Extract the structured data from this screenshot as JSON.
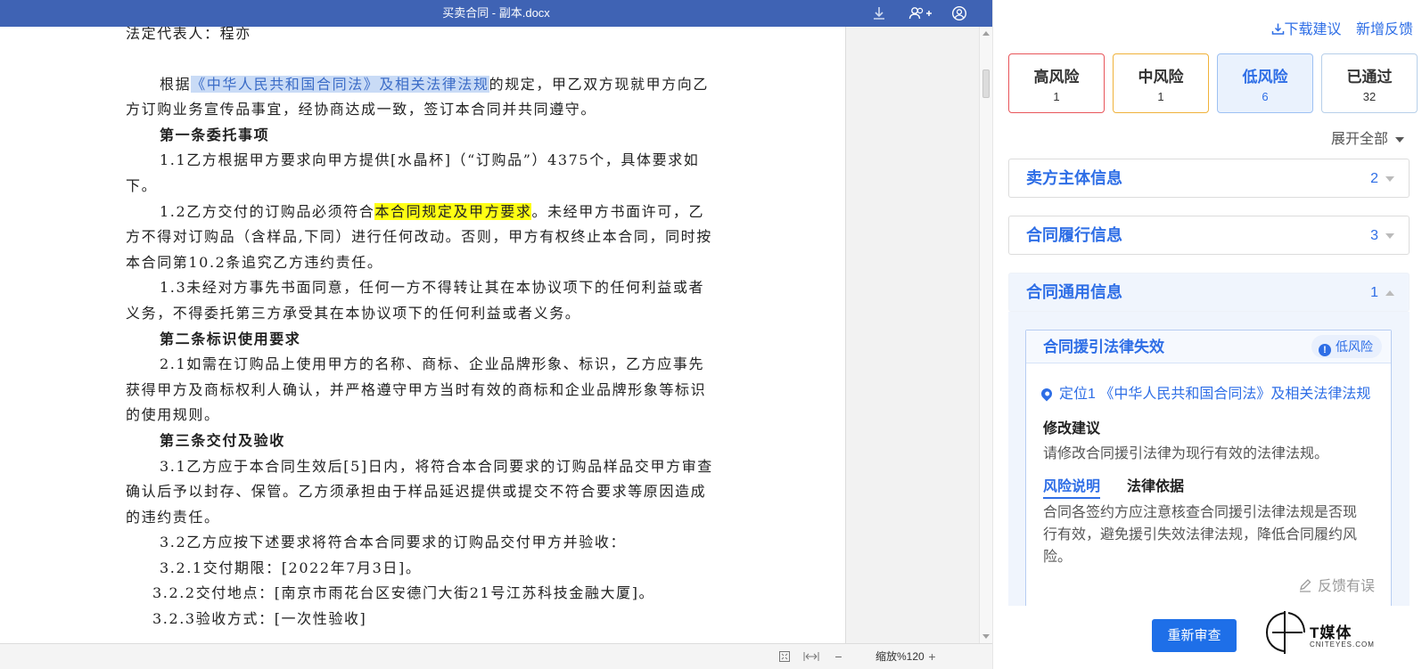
{
  "window": {
    "title": "买卖合同 - 副本.docx",
    "icons": [
      "download-icon",
      "add-user-icon",
      "account-icon"
    ]
  },
  "document": {
    "top_line": "法定代表人：程亦",
    "intro_prefix": "根据",
    "intro_highlight": "《中华人民共和国合同法》及相关法律法规",
    "intro_suffix": "的规定，甲乙双方现就甲方向乙方订购业务宣传品事宜，经协商达成一致，签订本合同并共同遵守。",
    "art1_title": "第一条委托事项",
    "art1_1": "1.1乙方根据甲方要求向甲方提供[水晶杯]（“订购品”）4375个，具体要求如下。",
    "art1_2_prefix": "1.2乙方交付的订购品必须符合",
    "art1_2_highlight": "本合同规定及甲方要求",
    "art1_2_suffix": "。未经甲方书面许可，乙方不得对订购品（含样品,下同）进行任何改动。否则，甲方有权终止本合同，同时按本合同第10.2条追究乙方违约责任。",
    "art1_3": "1.3未经对方事先书面同意，任何一方不得转让其在本协议项下的任何利益或者义务，不得委托第三方承受其在本协议项下的任何利益或者义务。",
    "art2_title": "第二条标识使用要求",
    "art2_1": "2.1如需在订购品上使用甲方的名称、商标、企业品牌形象、标识，乙方应事先获得甲方及商标权利人确认，并严格遵守甲方当时有效的商标和企业品牌形象等标识的使用规则。",
    "art3_title": "第三条交付及验收",
    "art3_1": "3.1乙方应于本合同生效后[5]日内，将符合本合同要求的订购品样品交甲方审查确认后予以封存、保管。乙方须承担由于样品延迟提供或提交不符合要求等原因造成的违约责任。",
    "art3_2": "3.2乙方应按下述要求将符合本合同要求的订购品交付甲方并验收：",
    "art3_2_1": "3.2.1交付期限：[2022年7月3日]。",
    "art3_2_2": "3.2.2交付地点：[南京市雨花台区安德门大街21号江苏科技金融大厦]。",
    "art3_2_3": "3.2.3验收方式：[一次性验收]"
  },
  "statusbar": {
    "zoom": "缩放%120",
    "icons": [
      "fit-page-icon",
      "fit-width-icon",
      "zoom-out-icon",
      "zoom-in-icon"
    ],
    "zoom_out": "−",
    "zoom_in": "+"
  },
  "panel": {
    "download_label": "下载建议",
    "feedback_label": "新增反馈",
    "risk_cards": [
      {
        "label": "高风险",
        "count": "1",
        "color": "#e8555a"
      },
      {
        "label": "中风险",
        "count": "1",
        "color": "#f0b23a"
      },
      {
        "label": "低风险",
        "count": "6",
        "color": "#2e6ee6"
      },
      {
        "label": "已通过",
        "count": "32",
        "color": "#b7cfe9"
      }
    ],
    "expand_all": "展开全部",
    "sections": [
      {
        "title": "卖方主体信息",
        "count": "2"
      },
      {
        "title": "合同履行信息",
        "count": "3"
      },
      {
        "title": "合同通用信息",
        "count": "1"
      }
    ],
    "issue": {
      "title": "合同援引法律失效",
      "badge": "低风险",
      "locate": "定位1 《中华人民共和国合同法》及相关法律法规",
      "suggest_title": "修改建议",
      "suggest_text": "请修改合同援引法律为现行有效的法律法规。",
      "tab_risk": "风险说明",
      "tab_law": "法律依据",
      "risk_text": "合同各签约方应注意核查合同援引法律法规是否现行有效，避免援引失效法律法规，降低合同履约风险。",
      "feedback": "反馈有误"
    },
    "re_review": "重新审查",
    "watermark": {
      "cn": "T媒体",
      "en": "CNITEYES.COM"
    },
    "accent_color": "#2e6ee6"
  }
}
